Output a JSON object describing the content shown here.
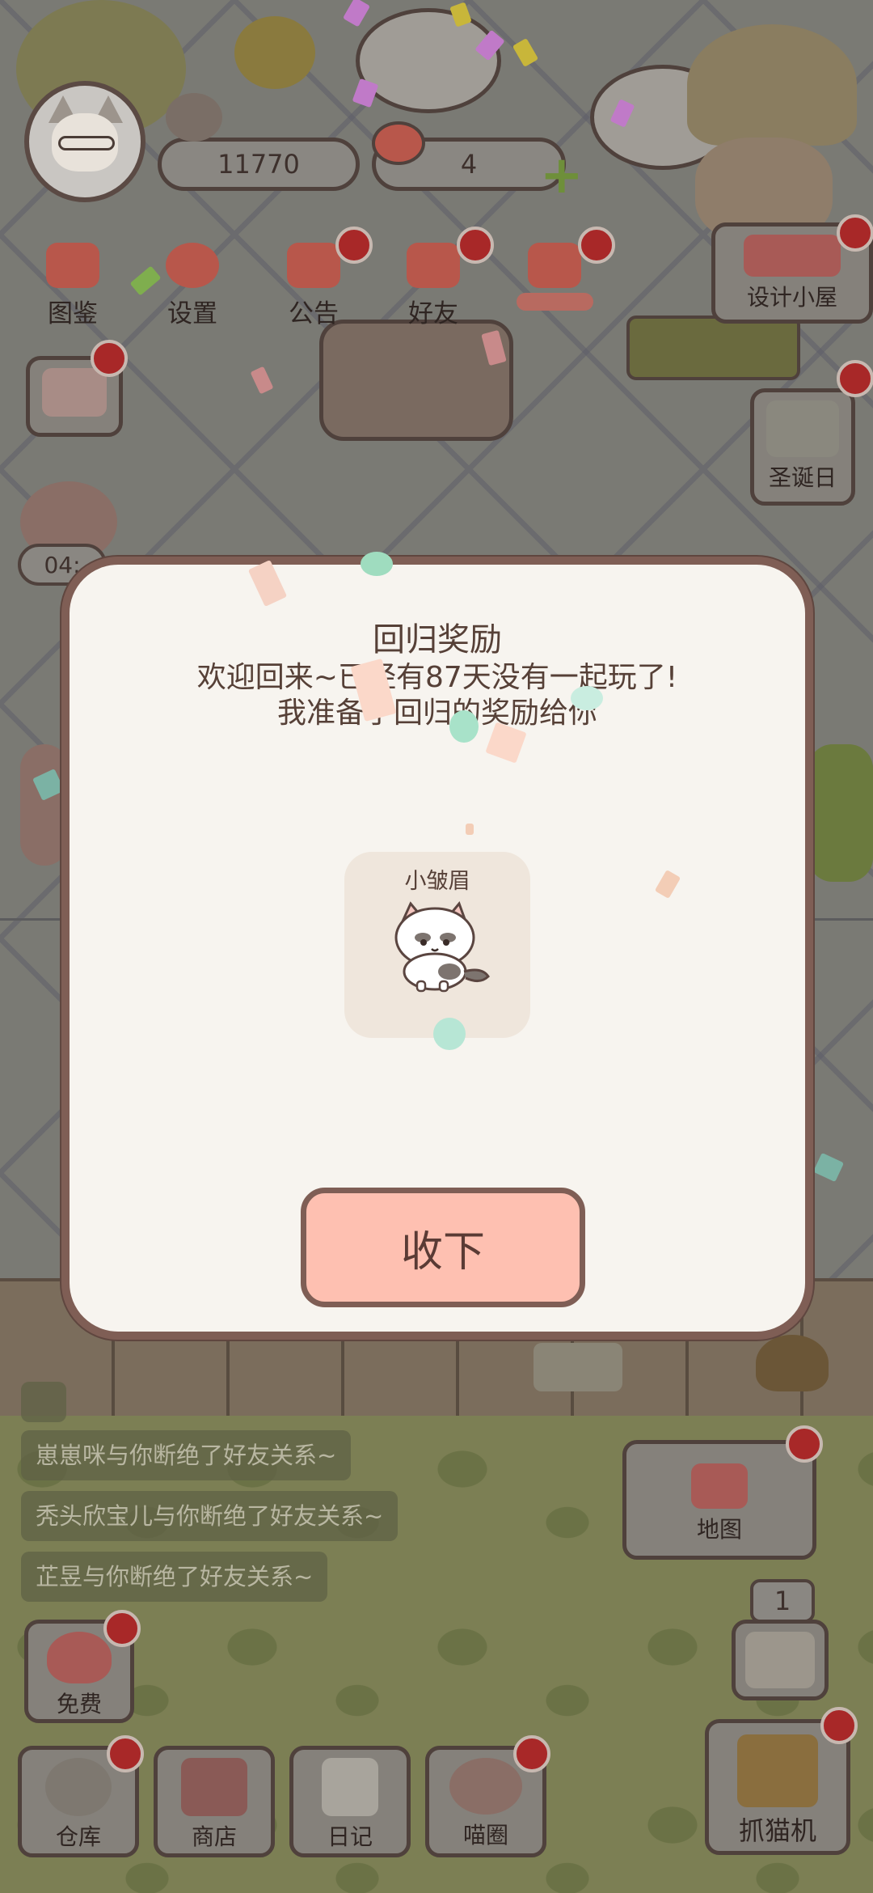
{
  "hud": {
    "coins": "11770",
    "tokens": "4"
  },
  "nav": {
    "items": [
      {
        "label": "图鉴"
      },
      {
        "label": "设置"
      },
      {
        "label": "公告"
      },
      {
        "label": "好友"
      }
    ],
    "design_house": "设计小屋",
    "christmas": "圣诞日",
    "timer": "04:"
  },
  "modal": {
    "title": "回归奖励",
    "message_line1": "欢迎回来~已经有87天没有一起玩了!",
    "message_line2": "我准备了回归的奖励给你",
    "reward_name": "小皱眉",
    "accept_button": "收下"
  },
  "chat": {
    "messages": [
      "崽崽咪与你断绝了好友关系~",
      "秃头欣宝儿与你断绝了好友关系~",
      "芷昱与你断绝了好友关系~"
    ]
  },
  "right": {
    "map_label": "地图",
    "slot_count": "1",
    "claw_label": "抓猫机"
  },
  "bottom": {
    "free_label": "免费",
    "items": [
      {
        "label": "仓库"
      },
      {
        "label": "商店"
      },
      {
        "label": "日记"
      },
      {
        "label": "喵圈"
      }
    ]
  },
  "colors": {
    "modal_bg": "#f7f4ef",
    "modal_border": "#7f5e55",
    "button_bg": "#fec0b1",
    "notification_dot": "#a82828"
  }
}
